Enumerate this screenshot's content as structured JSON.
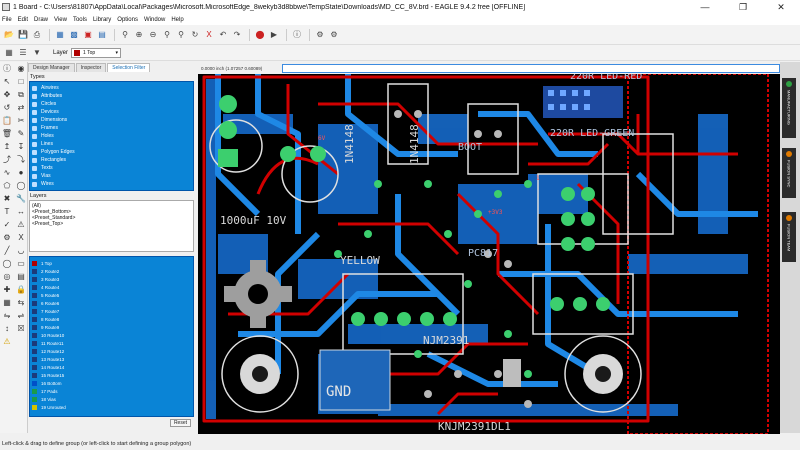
{
  "window": {
    "title": "1 Board - C:\\Users\\81807\\AppData\\Local\\Packages\\Microsoft.MicrosoftEdge_8wekyb3d8bbwe\\TempState\\Downloads\\MD_CC_8V.brd - EAGLE 9.4.2 free [OFFLINE]"
  },
  "menu": [
    "File",
    "Edit",
    "Draw",
    "View",
    "Tools",
    "Library",
    "Options",
    "Window",
    "Help"
  ],
  "toolbar2": {
    "layer_label": "Layer",
    "layer_value": "1 Top",
    "layer_color": "#b00000"
  },
  "panel": {
    "tabs": [
      "Design Manager",
      "Inspector",
      "Selection Filter"
    ],
    "types_title": "Types",
    "types": [
      "Airwires",
      "Attributes",
      "Circles",
      "Devices",
      "Dimensions",
      "Frames",
      "Holes",
      "Lines",
      "Polygon Edges",
      "Rectangles",
      "Texts",
      "Vias",
      "Wires"
    ],
    "layers_title": "Layers",
    "layer_sets": [
      "(All)",
      "<Preset_Bottom>",
      "<Preset_Standard>",
      "<Preset_Top>"
    ],
    "layer_list": [
      {
        "name": "1 Top",
        "color": "#b00000"
      },
      {
        "name": "2 Route2",
        "color": "#1c3a7a"
      },
      {
        "name": "3 Route3",
        "color": "#1c3a7a"
      },
      {
        "name": "4 Route4",
        "color": "#1c3a7a"
      },
      {
        "name": "5 Route5",
        "color": "#1c3a7a"
      },
      {
        "name": "6 Route6",
        "color": "#1c3a7a"
      },
      {
        "name": "7 Route7",
        "color": "#1c3a7a"
      },
      {
        "name": "8 Route8",
        "color": "#1c3a7a"
      },
      {
        "name": "9 Route9",
        "color": "#1c3a7a"
      },
      {
        "name": "10 Route10",
        "color": "#1c3a7a"
      },
      {
        "name": "11 Route11",
        "color": "#1c3a7a"
      },
      {
        "name": "12 Route12",
        "color": "#1c3a7a"
      },
      {
        "name": "13 Route13",
        "color": "#1c3a7a"
      },
      {
        "name": "14 Route14",
        "color": "#1c3a7a"
      },
      {
        "name": "15 Route15",
        "color": "#1c3a7a"
      },
      {
        "name": "16 Bottom",
        "color": "#0050c8"
      },
      {
        "name": "17 Pads",
        "color": "#1a9a4a"
      },
      {
        "name": "18 Vias",
        "color": "#1a9a4a"
      },
      {
        "name": "19 Unrouted",
        "color": "#d4c400"
      }
    ],
    "reset_label": "Reset"
  },
  "coord_readout": "0.0000 inch (1.07257 0.60089)",
  "command_value": "",
  "right_tabs": [
    {
      "label": "MANUFACTURING",
      "color": "#2ea043"
    },
    {
      "label": "FUSION SYNC",
      "color": "#e07a00"
    },
    {
      "label": "FUSION TEAM",
      "color": "#e07a00"
    }
  ],
  "board_text": {
    "t1": "1N4148",
    "t2": "1N4148",
    "t3": "1000uF 10V",
    "t4": "BOOT",
    "t5": "220R LED-RED",
    "t6": "220R LED-GREEN",
    "t7": "YELLOW",
    "t8": "PC817",
    "t9": "GND",
    "t10": "NJM2391",
    "t11": "KNJM2391DL1",
    "t12": "+3V3",
    "t13": "6V",
    "t14": "1"
  },
  "status": "Left-click & drag to define group (or left-click to start defining a group polygon)"
}
